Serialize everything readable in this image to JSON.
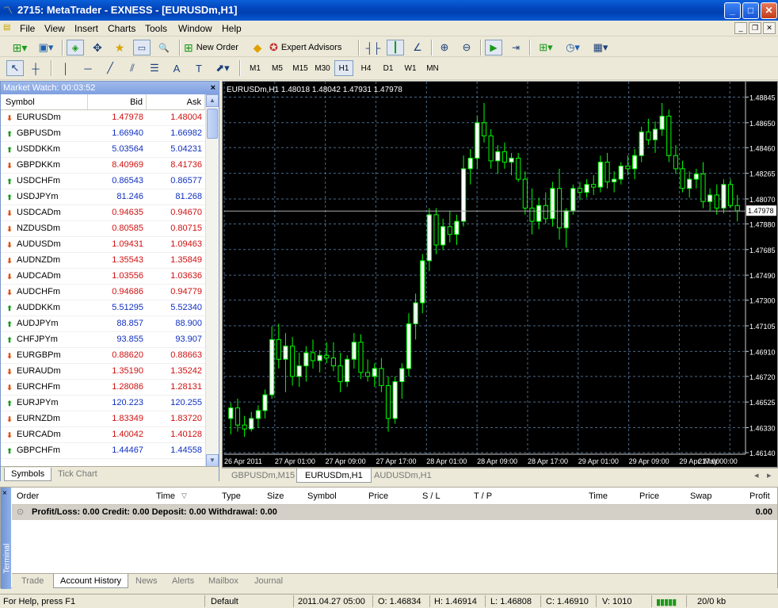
{
  "window": {
    "title": "2715: MetaTrader - EXNESS  - [EURUSDm,H1]"
  },
  "menu": [
    "File",
    "View",
    "Insert",
    "Charts",
    "Tools",
    "Window",
    "Help"
  ],
  "toolbar": {
    "new_order": "New Order",
    "expert_advisors": "Expert Advisors"
  },
  "timeframes": [
    "M1",
    "M5",
    "M15",
    "M30",
    "H1",
    "H4",
    "D1",
    "W1",
    "MN"
  ],
  "timeframe_selected": "H1",
  "market_watch": {
    "title": "Market Watch: 00:03:52",
    "columns": [
      "Symbol",
      "Bid",
      "Ask"
    ],
    "rows": [
      {
        "symbol": "EURUSDm",
        "bid": "1.47978",
        "ask": "1.48004",
        "dir": "down"
      },
      {
        "symbol": "GBPUSDm",
        "bid": "1.66940",
        "ask": "1.66982",
        "dir": "up"
      },
      {
        "symbol": "USDDKKm",
        "bid": "5.03564",
        "ask": "5.04231",
        "dir": "up"
      },
      {
        "symbol": "GBPDKKm",
        "bid": "8.40969",
        "ask": "8.41736",
        "dir": "down"
      },
      {
        "symbol": "USDCHFm",
        "bid": "0.86543",
        "ask": "0.86577",
        "dir": "up"
      },
      {
        "symbol": "USDJPYm",
        "bid": "81.246",
        "ask": "81.268",
        "dir": "up"
      },
      {
        "symbol": "USDCADm",
        "bid": "0.94635",
        "ask": "0.94670",
        "dir": "down"
      },
      {
        "symbol": "NZDUSDm",
        "bid": "0.80585",
        "ask": "0.80715",
        "dir": "down"
      },
      {
        "symbol": "AUDUSDm",
        "bid": "1.09431",
        "ask": "1.09463",
        "dir": "down"
      },
      {
        "symbol": "AUDNZDm",
        "bid": "1.35543",
        "ask": "1.35849",
        "dir": "down"
      },
      {
        "symbol": "AUDCADm",
        "bid": "1.03556",
        "ask": "1.03636",
        "dir": "down"
      },
      {
        "symbol": "AUDCHFm",
        "bid": "0.94686",
        "ask": "0.94779",
        "dir": "down"
      },
      {
        "symbol": "AUDDKKm",
        "bid": "5.51295",
        "ask": "5.52340",
        "dir": "up"
      },
      {
        "symbol": "AUDJPYm",
        "bid": "88.857",
        "ask": "88.900",
        "dir": "up"
      },
      {
        "symbol": "CHFJPYm",
        "bid": "93.855",
        "ask": "93.907",
        "dir": "up"
      },
      {
        "symbol": "EURGBPm",
        "bid": "0.88620",
        "ask": "0.88663",
        "dir": "down"
      },
      {
        "symbol": "EURAUDm",
        "bid": "1.35190",
        "ask": "1.35242",
        "dir": "down"
      },
      {
        "symbol": "EURCHFm",
        "bid": "1.28086",
        "ask": "1.28131",
        "dir": "down"
      },
      {
        "symbol": "EURJPYm",
        "bid": "120.223",
        "ask": "120.255",
        "dir": "up"
      },
      {
        "symbol": "EURNZDm",
        "bid": "1.83349",
        "ask": "1.83720",
        "dir": "down"
      },
      {
        "symbol": "EURCADm",
        "bid": "1.40042",
        "ask": "1.40128",
        "dir": "down"
      },
      {
        "symbol": "GBPCHFm",
        "bid": "1.44467",
        "ask": "1.44558",
        "dir": "up"
      }
    ],
    "tabs": [
      "Symbols",
      "Tick Chart"
    ]
  },
  "chart": {
    "header": "EURUSDm,H1  1.48018 1.48042 1.47931 1.47978",
    "price_labels": [
      "1.48845",
      "1.48650",
      "1.48460",
      "1.48265",
      "1.48070",
      "1.47880",
      "1.47685",
      "1.47490",
      "1.47300",
      "1.47105",
      "1.46910",
      "1.46720",
      "1.46525",
      "1.46330",
      "1.46140"
    ],
    "current_price": "1.47978",
    "time_labels": [
      "26 Apr 2011",
      "27 Apr 01:00",
      "27 Apr 09:00",
      "27 Apr 17:00",
      "28 Apr 01:00",
      "28 Apr 09:00",
      "28 Apr 17:00",
      "29 Apr 01:00",
      "29 Apr 09:00",
      "29 Apr 17:00",
      "2 May 00:00"
    ],
    "bull_color": "#ffffff",
    "bear_color": "#000000",
    "wick_color": "#00ff00",
    "grid_color": "#4a6a8a"
  },
  "chart_data": {
    "type": "candlestick",
    "y_range": [
      1.4614,
      1.4889
    ],
    "ohlc": [
      [
        1.464,
        1.4652,
        1.4628,
        1.4648
      ],
      [
        1.4648,
        1.4655,
        1.463,
        1.4635
      ],
      [
        1.4635,
        1.4642,
        1.4626,
        1.4632
      ],
      [
        1.4632,
        1.4645,
        1.463,
        1.464
      ],
      [
        1.464,
        1.465,
        1.4633,
        1.4646
      ],
      [
        1.4646,
        1.4662,
        1.464,
        1.4658
      ],
      [
        1.4658,
        1.471,
        1.4655,
        1.47
      ],
      [
        1.47,
        1.4712,
        1.4678,
        1.4685
      ],
      [
        1.4685,
        1.4705,
        1.466,
        1.4695
      ],
      [
        1.4695,
        1.4702,
        1.4665,
        1.4672
      ],
      [
        1.4672,
        1.469,
        1.4664,
        1.468
      ],
      [
        1.468,
        1.4695,
        1.4668,
        1.469
      ],
      [
        1.469,
        1.47,
        1.4678,
        1.4684
      ],
      [
        1.4684,
        1.4692,
        1.4675,
        1.4688
      ],
      [
        1.4688,
        1.4698,
        1.4682,
        1.4686
      ],
      [
        1.4686,
        1.4698,
        1.4676,
        1.468
      ],
      [
        1.468,
        1.469,
        1.466,
        1.4668
      ],
      [
        1.4668,
        1.4688,
        1.4664,
        1.4685
      ],
      [
        1.4685,
        1.4705,
        1.4678,
        1.4698
      ],
      [
        1.4698,
        1.4704,
        1.467,
        1.4675
      ],
      [
        1.4675,
        1.4685,
        1.4668,
        1.4672
      ],
      [
        1.4672,
        1.4682,
        1.4664,
        1.4678
      ],
      [
        1.4678,
        1.4686,
        1.466,
        1.4665
      ],
      [
        1.4665,
        1.4672,
        1.463,
        1.464
      ],
      [
        1.464,
        1.4672,
        1.4636,
        1.4668
      ],
      [
        1.4668,
        1.4682,
        1.4655,
        1.4678
      ],
      [
        1.4678,
        1.472,
        1.4672,
        1.4712
      ],
      [
        1.4712,
        1.4735,
        1.47,
        1.4728
      ],
      [
        1.4728,
        1.4765,
        1.472,
        1.476
      ],
      [
        1.476,
        1.48,
        1.4752,
        1.4795
      ],
      [
        1.4795,
        1.48,
        1.4765,
        1.4772
      ],
      [
        1.4772,
        1.4792,
        1.4768,
        1.4786
      ],
      [
        1.4786,
        1.4798,
        1.4774,
        1.478
      ],
      [
        1.478,
        1.4795,
        1.4772,
        1.479
      ],
      [
        1.479,
        1.484,
        1.4786,
        1.483
      ],
      [
        1.483,
        1.4845,
        1.4818,
        1.4838
      ],
      [
        1.4838,
        1.487,
        1.483,
        1.4865
      ],
      [
        1.4865,
        1.488,
        1.485,
        1.4855
      ],
      [
        1.4855,
        1.486,
        1.483,
        1.4836
      ],
      [
        1.4836,
        1.4848,
        1.4826,
        1.4843
      ],
      [
        1.4843,
        1.485,
        1.483,
        1.4835
      ],
      [
        1.4835,
        1.4842,
        1.4825,
        1.4838
      ],
      [
        1.4838,
        1.4842,
        1.482,
        1.4822
      ],
      [
        1.4822,
        1.4828,
        1.4795,
        1.48
      ],
      [
        1.48,
        1.4815,
        1.478,
        1.479
      ],
      [
        1.479,
        1.4808,
        1.4784,
        1.4802
      ],
      [
        1.4802,
        1.4812,
        1.4788,
        1.4792
      ],
      [
        1.4792,
        1.482,
        1.4786,
        1.4815
      ],
      [
        1.4815,
        1.483,
        1.4776,
        1.4785
      ],
      [
        1.4785,
        1.48,
        1.477,
        1.4798
      ],
      [
        1.4798,
        1.4818,
        1.4795,
        1.4815
      ],
      [
        1.4815,
        1.482,
        1.4806,
        1.4812
      ],
      [
        1.4812,
        1.4822,
        1.4808,
        1.4818
      ],
      [
        1.4818,
        1.4825,
        1.481,
        1.4816
      ],
      [
        1.4816,
        1.484,
        1.4812,
        1.4835
      ],
      [
        1.4835,
        1.4842,
        1.4815,
        1.482
      ],
      [
        1.482,
        1.4828,
        1.4812,
        1.4822
      ],
      [
        1.4822,
        1.4835,
        1.4818,
        1.4832
      ],
      [
        1.4832,
        1.484,
        1.4825,
        1.483
      ],
      [
        1.483,
        1.4845,
        1.4822,
        1.484
      ],
      [
        1.484,
        1.4862,
        1.4835,
        1.4858
      ],
      [
        1.4858,
        1.4868,
        1.4848,
        1.4852
      ],
      [
        1.4852,
        1.4866,
        1.4842,
        1.486
      ],
      [
        1.486,
        1.488,
        1.4855,
        1.487
      ],
      [
        1.487,
        1.4875,
        1.4835,
        1.484
      ],
      [
        1.484,
        1.4848,
        1.4826,
        1.483
      ],
      [
        1.483,
        1.4836,
        1.4812,
        1.4815
      ],
      [
        1.4815,
        1.4828,
        1.4808,
        1.4822
      ],
      [
        1.4822,
        1.483,
        1.4815,
        1.4826
      ],
      [
        1.4826,
        1.4835,
        1.48,
        1.4805
      ],
      [
        1.4805,
        1.4815,
        1.4798,
        1.481
      ],
      [
        1.481,
        1.4818,
        1.4795,
        1.48
      ],
      [
        1.48,
        1.4822,
        1.4796,
        1.4818
      ],
      [
        1.4818,
        1.4822,
        1.48,
        1.4802
      ],
      [
        1.4802,
        1.481,
        1.479,
        1.4798
      ]
    ],
    "current": 1.47978
  },
  "chart_tabs": [
    "GBPUSDm,M15",
    "EURUSDm,H1",
    "AUDUSDm,H1"
  ],
  "terminal": {
    "side_label": "Terminal",
    "columns": [
      "Order",
      "Time",
      "Type",
      "Size",
      "Symbol",
      "Price",
      "S / L",
      "T / P",
      "Time",
      "Price",
      "Swap",
      "Profit"
    ],
    "summary": "Profit/Loss: 0.00  Credit: 0.00  Deposit: 0.00  Withdrawal: 0.00",
    "summary_profit": "0.00",
    "tabs": [
      "Trade",
      "Account History",
      "News",
      "Alerts",
      "Mailbox",
      "Journal"
    ]
  },
  "status": {
    "help": "For Help, press F1",
    "profile": "Default",
    "datetime": "2011.04.27 05:00",
    "open": "O: 1.46834",
    "high": "H: 1.46914",
    "low": "L: 1.46808",
    "close": "C: 1.46910",
    "volume": "V: 1010",
    "traffic": "20/0 kb"
  }
}
